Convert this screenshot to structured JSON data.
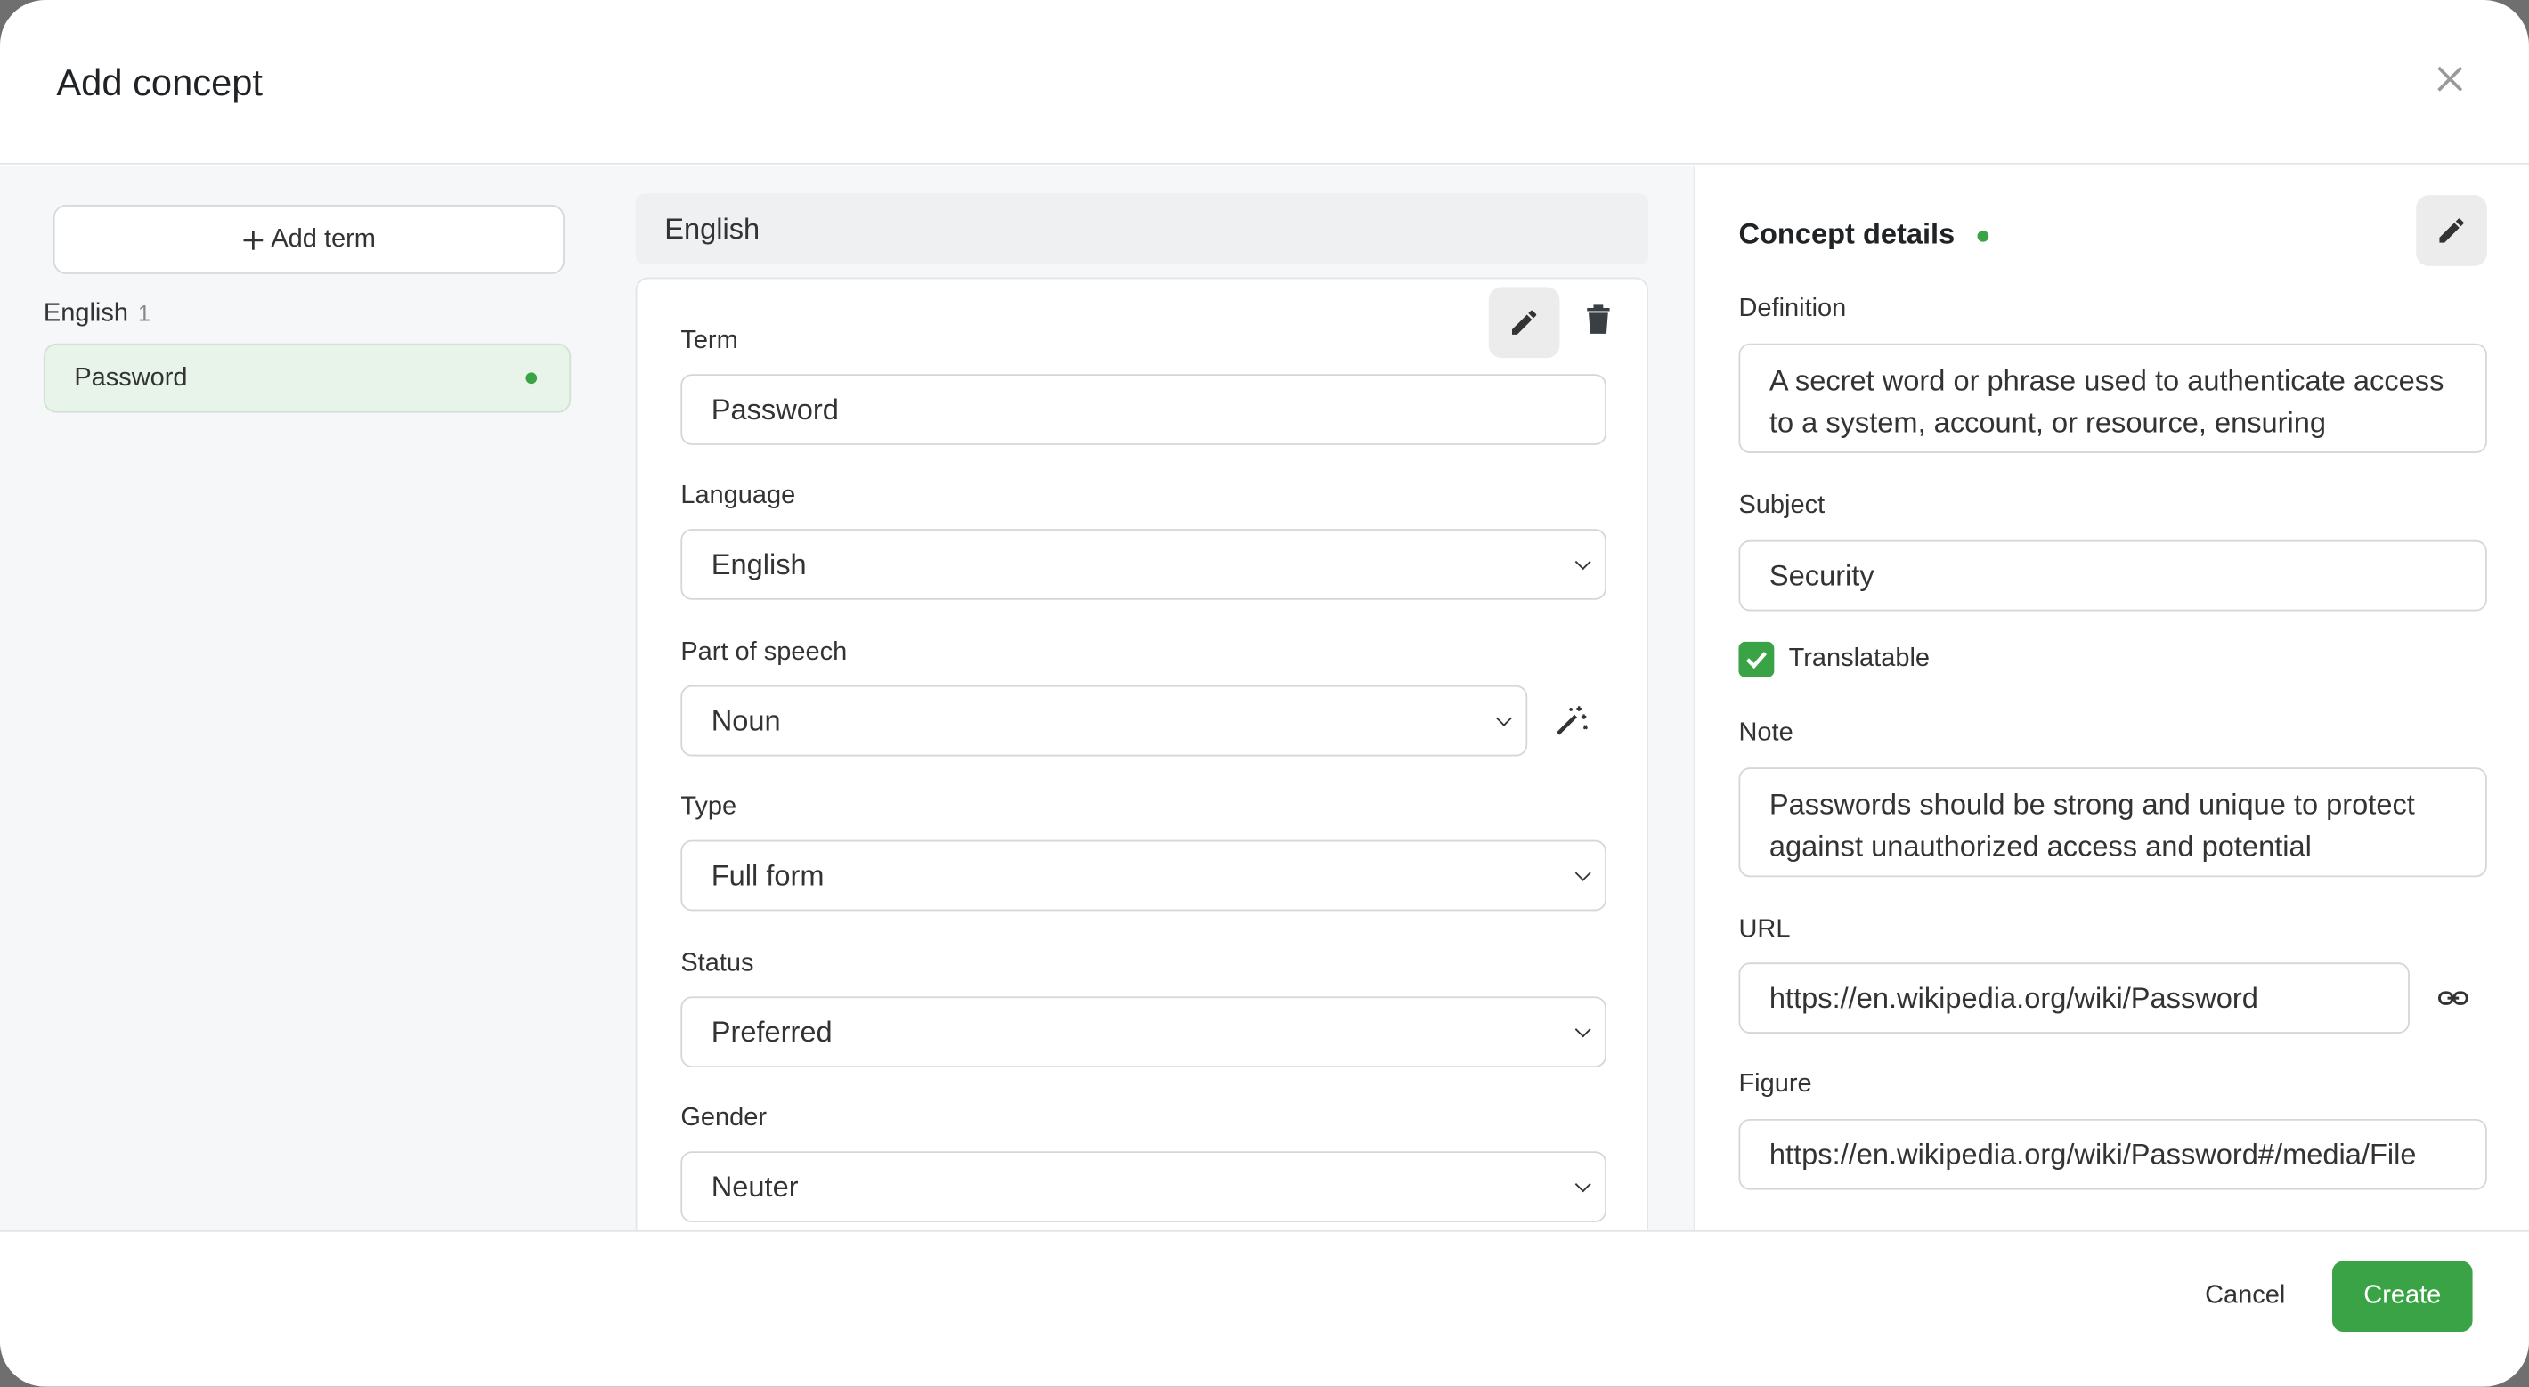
{
  "dialog": {
    "title": "Add concept",
    "close_icon": "close-icon"
  },
  "terms_panel": {
    "add_term_label": "Add term",
    "groups": [
      {
        "language": "English",
        "count": "1",
        "items": [
          {
            "label": "Password",
            "status_color": "#3aa346"
          }
        ]
      }
    ]
  },
  "term_editor": {
    "language_header": "English",
    "fields": {
      "term": {
        "label": "Term",
        "value": "Password"
      },
      "language": {
        "label": "Language",
        "value": "English"
      },
      "part_of_speech": {
        "label": "Part of speech",
        "value": "Noun"
      },
      "type": {
        "label": "Type",
        "value": "Full form"
      },
      "status": {
        "label": "Status",
        "value": "Preferred"
      },
      "gender": {
        "label": "Gender",
        "value": "Neuter"
      }
    }
  },
  "concept_details": {
    "title": "Concept details",
    "definition": {
      "label": "Definition",
      "value": "A secret word or phrase used to authenticate access to a system, account, or resource, ensuring"
    },
    "subject": {
      "label": "Subject",
      "value": "Security"
    },
    "translatable": {
      "label": "Translatable",
      "checked": true
    },
    "note": {
      "label": "Note",
      "value": "Passwords should be strong and unique to protect against unauthorized access and potential"
    },
    "url": {
      "label": "URL",
      "value": "https://en.wikipedia.org/wiki/Password"
    },
    "figure": {
      "label": "Figure",
      "value": "https://en.wikipedia.org/wiki/Password#/media/File"
    }
  },
  "footer": {
    "cancel_label": "Cancel",
    "create_label": "Create"
  },
  "colors": {
    "accent": "#3aa346",
    "selected_bg": "#e8f4ea"
  }
}
